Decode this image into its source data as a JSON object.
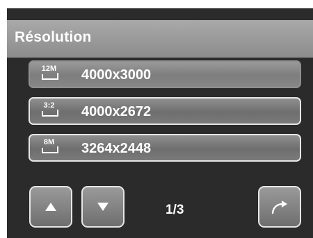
{
  "header": {
    "title": "Résolution"
  },
  "options": [
    {
      "icon_name": "size-12m-icon",
      "badge": "12M",
      "label": "4000x3000",
      "selected": true
    },
    {
      "icon_name": "ratio-3-2-icon",
      "badge": "3:2",
      "label": "4000x2672",
      "selected": false
    },
    {
      "icon_name": "size-8m-icon",
      "badge": "8M",
      "label": "3264x2448",
      "selected": false
    }
  ],
  "nav": {
    "up_icon": "arrow-up-icon",
    "down_icon": "arrow-down-icon",
    "page": "1/3",
    "back_icon": "return-arrow-icon"
  },
  "colors": {
    "header": "#9c9c9c",
    "background": "#2b2b2b",
    "button_border": "#e6e6e6",
    "text": "#ffffff"
  }
}
